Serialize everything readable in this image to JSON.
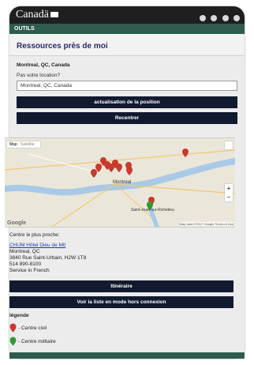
{
  "header": {
    "brand": "Canadä",
    "nav_label": "OUTILS"
  },
  "page": {
    "title": "Ressources près de moi"
  },
  "location": {
    "current": "Montreal, QC, Canada",
    "prompt": "Pas votre location?",
    "input_value": "Montreal, QC, Canada",
    "refresh_button": "actualisation de la position",
    "recenter_button": "Recentrer"
  },
  "map": {
    "tab_map": "Map",
    "tab_satellite": "Satellite",
    "zoom_in": "+",
    "zoom_out": "−",
    "city_label": "Montréal",
    "city2_label": "Saint-Jean-sur-Richelieu",
    "logo": "Google",
    "attribution": "Map data ©2017 Google  Terms of Use"
  },
  "nearest": {
    "label": "Centre le plus proche:",
    "name": "CHUM Hôtel Dieu de Mtl",
    "city": "Montreal, QC",
    "address": "3840 Rue Saint-Urbain, H2W 1T8",
    "phone": "514 890-8100",
    "service": "Service in French"
  },
  "actions": {
    "itinerary": "Itinéraire",
    "offline_list": "Voir la liste en mode hors connexion"
  },
  "legend": {
    "title": "légende",
    "civil": "- Centre civil",
    "military": "- Centre militaire"
  },
  "colors": {
    "nav": "#2f5b4f",
    "button": "#111a2e",
    "civil_pin": "#c83a2e",
    "military_pin": "#2f9a2f"
  }
}
